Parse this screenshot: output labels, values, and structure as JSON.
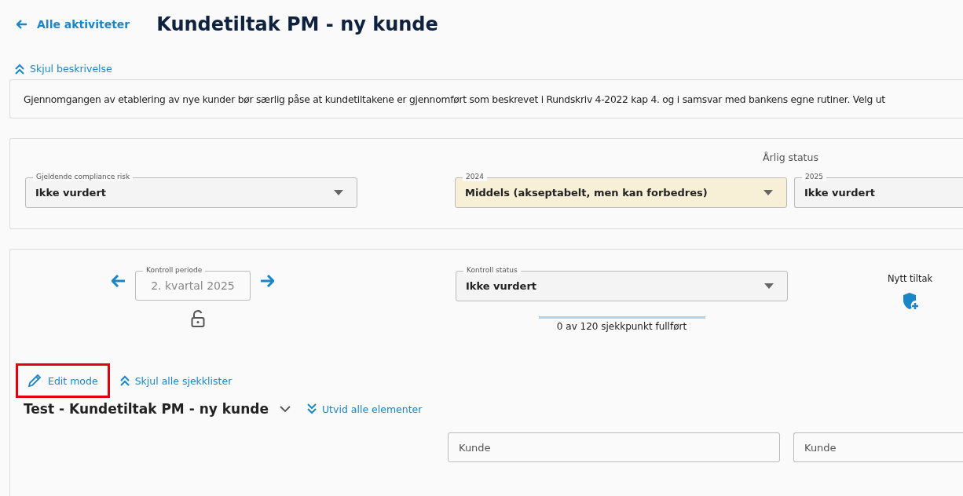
{
  "header": {
    "back_link": "Alle aktiviteter",
    "title": "Kundetiltak PM - ny kunde"
  },
  "description": {
    "toggle": "Skjul beskrivelse",
    "expanded": true,
    "text": "Gjennomgangen av etablering av nye kunder bør særlig påse at kundetiltakene er gjennomført som beskrevet i Rundskriv 4-2022 kap 4. og i samsvar med bankens egne rutiner. Velg ut"
  },
  "risk": {
    "current": {
      "label": "Gjeldende compliance risk",
      "value": "Ikke vurdert"
    },
    "annual_status_label": "Årlig status",
    "annual": [
      {
        "label": "2024",
        "value": "Middels (akseptabelt, men kan forbedres)",
        "color": "#f8f0d6"
      },
      {
        "label": "2025",
        "value": "Ikke vurdert",
        "color": "#f4f4f4"
      }
    ]
  },
  "control": {
    "period": {
      "label": "Kontroll periode",
      "value": "2. kvartal 2025",
      "disabled": true,
      "locked": false
    },
    "status": {
      "label": "Kontroll status",
      "value": "Ikke vurdert"
    },
    "progress": {
      "text": "0 av 120 sjekkpunkt fullført"
    },
    "new_measure": "Nytt tiltak",
    "edit_mode": {
      "label": "Edit mode",
      "highlighted": true
    },
    "collapse_all": "Skjul alle sjekklister",
    "checklist": {
      "title": "Test - Kundetiltak PM - ny kunde",
      "expanded": false,
      "expand_all": "Utvid alle elementer"
    },
    "fields": [
      {
        "placeholder": "Kunde"
      },
      {
        "placeholder": "Kunde"
      }
    ]
  }
}
